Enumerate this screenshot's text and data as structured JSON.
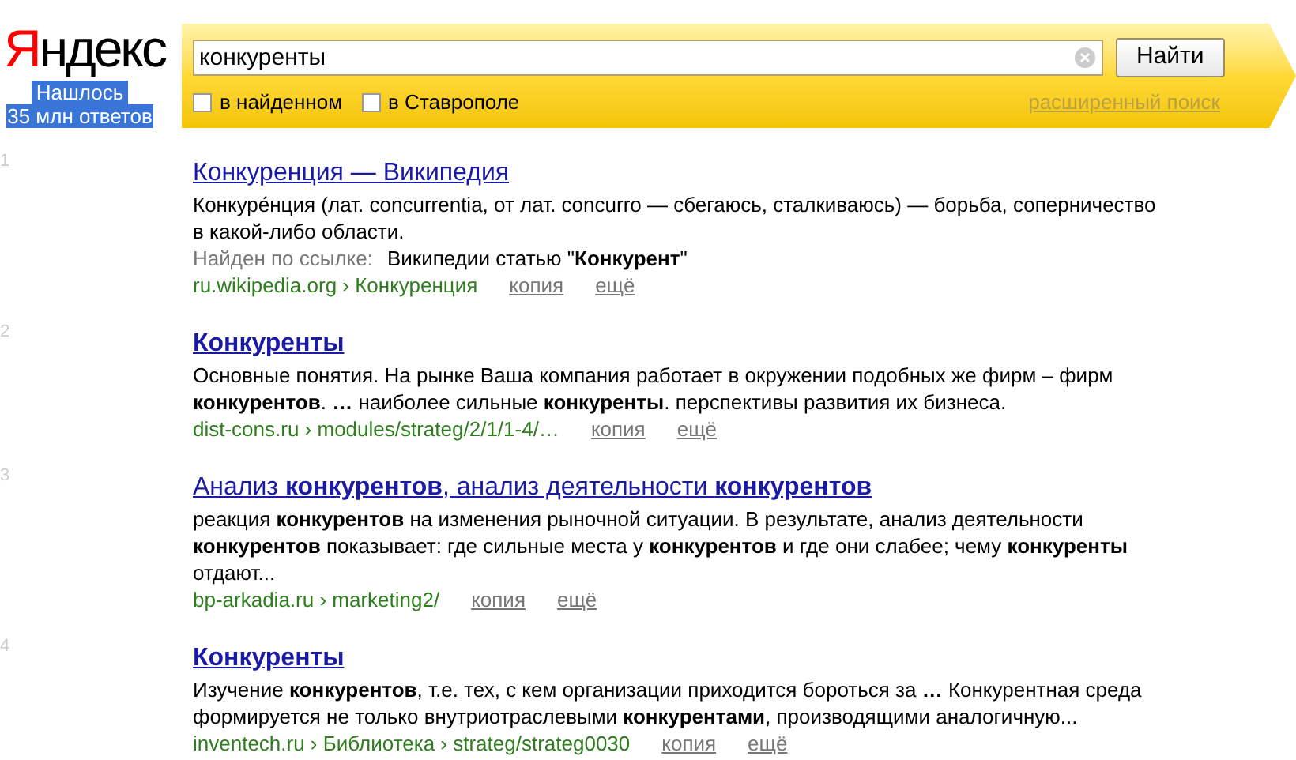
{
  "logo": {
    "first": "Я",
    "rest": "ндекс"
  },
  "found": {
    "line1": "Нашлось",
    "line2": "35 млн ответов"
  },
  "search": {
    "value": "конкуренты",
    "button": "Найти",
    "options": [
      {
        "label": "в найденном",
        "checked": false
      },
      {
        "label": "в Ставрополе",
        "checked": false
      }
    ],
    "advanced": "расширенный поиск"
  },
  "results": [
    {
      "number": "1",
      "title": "Конкуренция — Википедия",
      "bold": false,
      "snippet": "Конкуре́нция (лат. concurrentia, от лат. concurro — сбегаюсь, сталкиваюсь) — борьба, соперничество в какой-либо области.",
      "found_by": {
        "label": "Найден по ссылке:",
        "text": "Википедии статью \"**Конкурент**\""
      },
      "url": "ru.wikipedia.org › Конкуренция",
      "copy": "копия",
      "more": "ещё"
    },
    {
      "number": "2",
      "title": "Конкуренты",
      "bold": true,
      "snippet": "Основные понятия. На рынке Ваша компания работает в окружении подобных же фирм – фирм **конкурентов**. **…** наиболее сильные **конкуренты**. перспективы развития их бизнеса.",
      "url": "dist-cons.ru › modules/strateg/2/1/1-4/…",
      "copy": "копия",
      "more": "ещё"
    },
    {
      "number": "3",
      "title": "Анализ **конкурентов**, анализ деятельности **конкурентов**",
      "bold": false,
      "snippet": "реакция **конкурентов** на изменения рыночной ситуации. В результате, анализ деятельности **конкурентов** показывает: где сильные места у **конкурентов** и где они слабее; чему **конкуренты** отдают...",
      "url": "bp-arkadia.ru › marketing2/",
      "copy": "копия",
      "more": "ещё"
    },
    {
      "number": "4",
      "title": "Конкуренты",
      "bold": true,
      "snippet": "Изучение **конкурентов**, т.е. тех, с кем организации приходится бороться за **…** Конкурентная среда формируется не только внутриотраслевыми **конкурентами**, производящими аналогичную...",
      "url": "inventech.ru › Библиотека › strateg/strateg0030",
      "copy": "копия",
      "more": "ещё"
    }
  ]
}
